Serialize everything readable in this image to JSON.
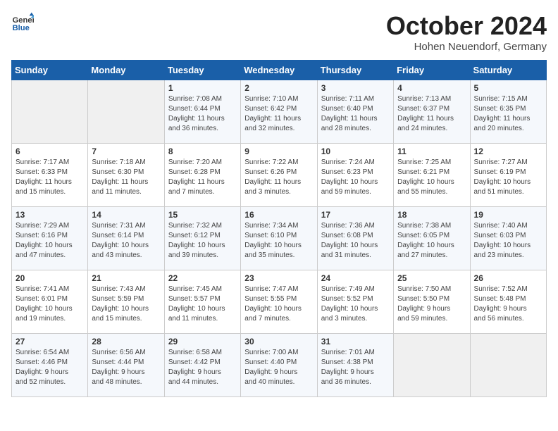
{
  "header": {
    "logo_line1": "General",
    "logo_line2": "Blue",
    "title": "October 2024",
    "subtitle": "Hohen Neuendorf, Germany"
  },
  "days_of_week": [
    "Sunday",
    "Monday",
    "Tuesday",
    "Wednesday",
    "Thursday",
    "Friday",
    "Saturday"
  ],
  "weeks": [
    [
      {
        "day": "",
        "info": ""
      },
      {
        "day": "",
        "info": ""
      },
      {
        "day": "1",
        "info": "Sunrise: 7:08 AM\nSunset: 6:44 PM\nDaylight: 11 hours\nand 36 minutes."
      },
      {
        "day": "2",
        "info": "Sunrise: 7:10 AM\nSunset: 6:42 PM\nDaylight: 11 hours\nand 32 minutes."
      },
      {
        "day": "3",
        "info": "Sunrise: 7:11 AM\nSunset: 6:40 PM\nDaylight: 11 hours\nand 28 minutes."
      },
      {
        "day": "4",
        "info": "Sunrise: 7:13 AM\nSunset: 6:37 PM\nDaylight: 11 hours\nand 24 minutes."
      },
      {
        "day": "5",
        "info": "Sunrise: 7:15 AM\nSunset: 6:35 PM\nDaylight: 11 hours\nand 20 minutes."
      }
    ],
    [
      {
        "day": "6",
        "info": "Sunrise: 7:17 AM\nSunset: 6:33 PM\nDaylight: 11 hours\nand 15 minutes."
      },
      {
        "day": "7",
        "info": "Sunrise: 7:18 AM\nSunset: 6:30 PM\nDaylight: 11 hours\nand 11 minutes."
      },
      {
        "day": "8",
        "info": "Sunrise: 7:20 AM\nSunset: 6:28 PM\nDaylight: 11 hours\nand 7 minutes."
      },
      {
        "day": "9",
        "info": "Sunrise: 7:22 AM\nSunset: 6:26 PM\nDaylight: 11 hours\nand 3 minutes."
      },
      {
        "day": "10",
        "info": "Sunrise: 7:24 AM\nSunset: 6:23 PM\nDaylight: 10 hours\nand 59 minutes."
      },
      {
        "day": "11",
        "info": "Sunrise: 7:25 AM\nSunset: 6:21 PM\nDaylight: 10 hours\nand 55 minutes."
      },
      {
        "day": "12",
        "info": "Sunrise: 7:27 AM\nSunset: 6:19 PM\nDaylight: 10 hours\nand 51 minutes."
      }
    ],
    [
      {
        "day": "13",
        "info": "Sunrise: 7:29 AM\nSunset: 6:16 PM\nDaylight: 10 hours\nand 47 minutes."
      },
      {
        "day": "14",
        "info": "Sunrise: 7:31 AM\nSunset: 6:14 PM\nDaylight: 10 hours\nand 43 minutes."
      },
      {
        "day": "15",
        "info": "Sunrise: 7:32 AM\nSunset: 6:12 PM\nDaylight: 10 hours\nand 39 minutes."
      },
      {
        "day": "16",
        "info": "Sunrise: 7:34 AM\nSunset: 6:10 PM\nDaylight: 10 hours\nand 35 minutes."
      },
      {
        "day": "17",
        "info": "Sunrise: 7:36 AM\nSunset: 6:08 PM\nDaylight: 10 hours\nand 31 minutes."
      },
      {
        "day": "18",
        "info": "Sunrise: 7:38 AM\nSunset: 6:05 PM\nDaylight: 10 hours\nand 27 minutes."
      },
      {
        "day": "19",
        "info": "Sunrise: 7:40 AM\nSunset: 6:03 PM\nDaylight: 10 hours\nand 23 minutes."
      }
    ],
    [
      {
        "day": "20",
        "info": "Sunrise: 7:41 AM\nSunset: 6:01 PM\nDaylight: 10 hours\nand 19 minutes."
      },
      {
        "day": "21",
        "info": "Sunrise: 7:43 AM\nSunset: 5:59 PM\nDaylight: 10 hours\nand 15 minutes."
      },
      {
        "day": "22",
        "info": "Sunrise: 7:45 AM\nSunset: 5:57 PM\nDaylight: 10 hours\nand 11 minutes."
      },
      {
        "day": "23",
        "info": "Sunrise: 7:47 AM\nSunset: 5:55 PM\nDaylight: 10 hours\nand 7 minutes."
      },
      {
        "day": "24",
        "info": "Sunrise: 7:49 AM\nSunset: 5:52 PM\nDaylight: 10 hours\nand 3 minutes."
      },
      {
        "day": "25",
        "info": "Sunrise: 7:50 AM\nSunset: 5:50 PM\nDaylight: 9 hours\nand 59 minutes."
      },
      {
        "day": "26",
        "info": "Sunrise: 7:52 AM\nSunset: 5:48 PM\nDaylight: 9 hours\nand 56 minutes."
      }
    ],
    [
      {
        "day": "27",
        "info": "Sunrise: 6:54 AM\nSunset: 4:46 PM\nDaylight: 9 hours\nand 52 minutes."
      },
      {
        "day": "28",
        "info": "Sunrise: 6:56 AM\nSunset: 4:44 PM\nDaylight: 9 hours\nand 48 minutes."
      },
      {
        "day": "29",
        "info": "Sunrise: 6:58 AM\nSunset: 4:42 PM\nDaylight: 9 hours\nand 44 minutes."
      },
      {
        "day": "30",
        "info": "Sunrise: 7:00 AM\nSunset: 4:40 PM\nDaylight: 9 hours\nand 40 minutes."
      },
      {
        "day": "31",
        "info": "Sunrise: 7:01 AM\nSunset: 4:38 PM\nDaylight: 9 hours\nand 36 minutes."
      },
      {
        "day": "",
        "info": ""
      },
      {
        "day": "",
        "info": ""
      }
    ]
  ]
}
